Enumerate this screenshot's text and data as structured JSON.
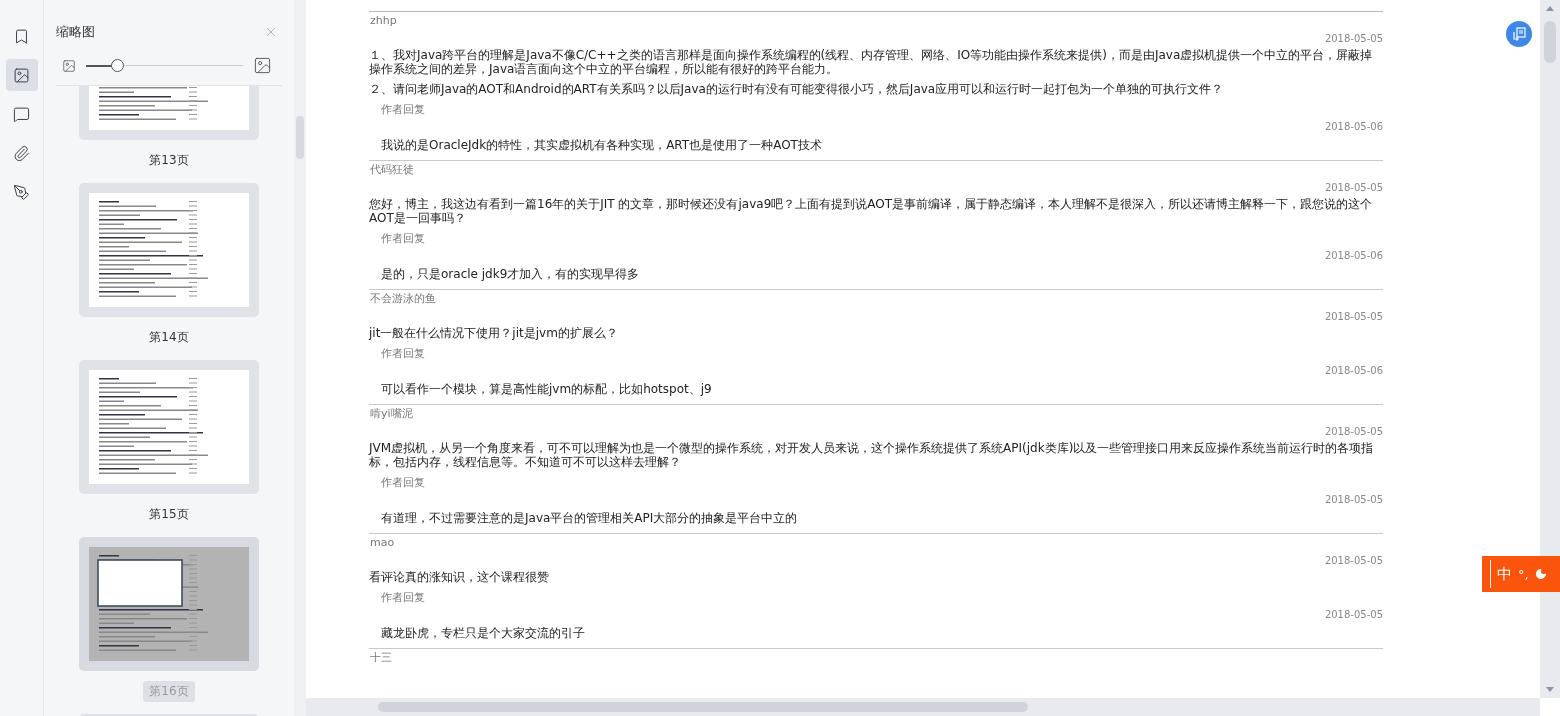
{
  "tool_rail": [
    {
      "kind": "bookmark",
      "selected": false
    },
    {
      "kind": "thumbnail",
      "selected": true
    },
    {
      "kind": "comment",
      "selected": false
    },
    {
      "kind": "attachment",
      "selected": false
    },
    {
      "kind": "signature",
      "selected": false
    }
  ],
  "thumbnail_panel": {
    "title": "缩略图",
    "zoom": {
      "level": 0.17
    },
    "pages": [
      {
        "label": "第13页",
        "selected": false
      },
      {
        "label": "第14页",
        "selected": false
      },
      {
        "label": "第15页",
        "selected": false
      },
      {
        "label": "第16页",
        "selected": true
      }
    ]
  },
  "comments": [
    {
      "author": "zhhp",
      "date": "2018-05-05",
      "paragraphs": [
        "１、我对Java跨平台的理解是Java不像C/C++之类的语言那样是面向操作系统编程的(线程、内存管理、网络、IO等功能由操作系统来提供)，而是由Java虚拟机提供一个中立的平台，屏蔽掉操作系统之间的差异，Java语言面向这个中立的平台编程，所以能有很好的跨平台能力。",
        "２、请问老师Java的AOT和Android的ART有关系吗？以后Java的运行时有没有可能变得很小巧，然后Java应用可以和运行时一起打包为一个单独的可执行文件？"
      ],
      "reply": {
        "label": "作者回复",
        "date": "2018-05-06",
        "text": "我说的是OracleJdk的特性，其实虚拟机有各种实现，ART也是使用了一种AOT技术"
      }
    },
    {
      "author": "代码狂徒",
      "date": "2018-05-05",
      "paragraphs": [
        "您好，博主，我这边有看到一篇16年的关于JIT 的文章，那时候还没有java9吧？上面有提到说AOT是事前编译，属于静态编译，本人理解不是很深入，所以还请博主解释一下，跟您说的这个AOT是一回事吗？"
      ],
      "reply": {
        "label": "作者回复",
        "date": "2018-05-06",
        "text": "是的，只是oracle jdk9才加入，有的实现早得多"
      }
    },
    {
      "author": "不会游泳的鱼",
      "date": "2018-05-05",
      "paragraphs": [
        "jit一般在什么情况下使用？jit是jvm的扩展么？"
      ],
      "reply": {
        "label": "作者回复",
        "date": "2018-05-06",
        "text": "可以看作一个模块，算是高性能jvm的标配，比如hotspot、j9"
      }
    },
    {
      "author": "啃yi嘴泥",
      "date": "2018-05-05",
      "paragraphs": [
        "JVM虚拟机，从另一个角度来看，可不可以理解为也是一个微型的操作系统，对开发人员来说，这个操作系统提供了系统API(jdk类库)以及一些管理接口用来反应操作系统当前运行时的各项指标，包括内存，线程信息等。不知道可不可以这样去理解？"
      ],
      "reply": {
        "label": "作者回复",
        "date": "2018-05-05",
        "text": "有道理，不过需要注意的是Java平台的管理相关API大部分的抽象是平台中立的"
      }
    },
    {
      "author": "mao",
      "date": "2018-05-05",
      "paragraphs": [
        "看评论真的涨知识，这个课程很赞"
      ],
      "reply": {
        "label": "作者回复",
        "date": "2018-05-05",
        "text": "藏龙卧虎，专栏只是个大家交流的引子"
      }
    },
    {
      "author": "十三"
    }
  ],
  "ime_bar": {
    "mode": "中",
    "punctuation": "°,"
  }
}
